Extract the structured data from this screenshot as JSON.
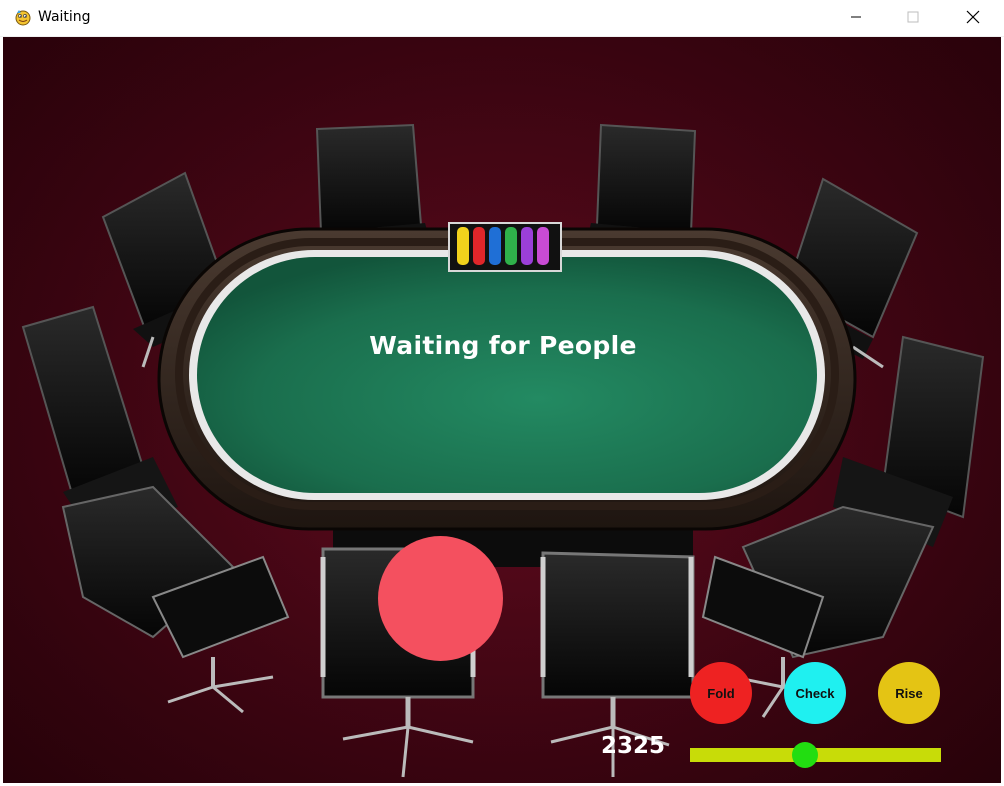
{
  "window": {
    "title": "Waiting",
    "icon": "pygame-snake-icon"
  },
  "table": {
    "status_text": "Waiting for People",
    "felt_color": "#1e7a55",
    "background_color": "#4a0616",
    "chip_colors": [
      "#f2d21c",
      "#e0262a",
      "#1f6fd6",
      "#2fb14a",
      "#9b3fd8",
      "#c94bd4"
    ]
  },
  "player": {
    "token_color": "#f4505f"
  },
  "controls": {
    "fold": {
      "label": "Fold",
      "color": "#ee2222"
    },
    "check": {
      "label": "Check",
      "color": "#1ff0f0"
    },
    "rise": {
      "label": "Rise",
      "color": "#e4c414"
    },
    "bet_amount": "2325",
    "slider": {
      "value_fraction": 0.46,
      "track_color": "#c8dc08",
      "thumb_color": "#22dd11"
    }
  }
}
